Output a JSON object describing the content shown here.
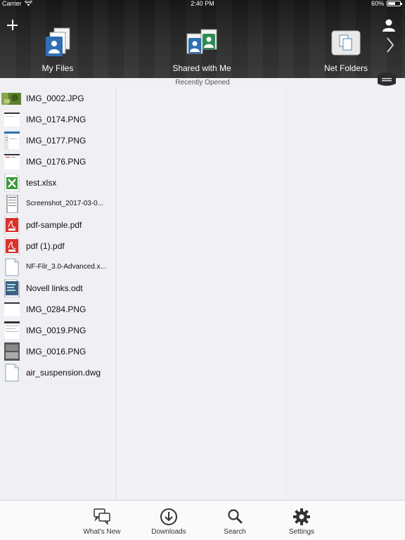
{
  "status": {
    "carrier": "Carrier",
    "time": "2:40 PM",
    "battery": "60%",
    "battery_level": 0.6
  },
  "header": {
    "tabs": [
      {
        "label": "My Files",
        "icon": "my-files-icon"
      },
      {
        "label": "Shared with Me",
        "icon": "shared-with-me-icon"
      },
      {
        "label": "Net Folders",
        "icon": "net-folders-icon"
      }
    ],
    "section_title": "Recently Opened"
  },
  "files": [
    {
      "name": "IMG_0002.JPG",
      "icon": "photo-thumbnail"
    },
    {
      "name": "IMG_0174.PNG",
      "icon": "screenshot-thumbnail"
    },
    {
      "name": "IMG_0177.PNG",
      "icon": "screenshot-thumbnail"
    },
    {
      "name": "IMG_0176.PNG",
      "icon": "screenshot-thumbnail"
    },
    {
      "name": "test.xlsx",
      "icon": "excel-icon"
    },
    {
      "name": "Screenshot_2017-03-0...",
      "icon": "screenshot-thumbnail"
    },
    {
      "name": "pdf-sample.pdf",
      "icon": "pdf-icon"
    },
    {
      "name": "pdf (1).pdf",
      "icon": "pdf-icon"
    },
    {
      "name": "NF-Filr_3.0-Advanced.x...",
      "icon": "generic-file-icon"
    },
    {
      "name": "Novell links.odt",
      "icon": "document-icon"
    },
    {
      "name": "IMG_0284.PNG",
      "icon": "screenshot-thumbnail"
    },
    {
      "name": "IMG_0019.PNG",
      "icon": "screenshot-thumbnail"
    },
    {
      "name": "IMG_0016.PNG",
      "icon": "screenshot-thumbnail"
    },
    {
      "name": "air_suspension.dwg",
      "icon": "generic-file-icon"
    }
  ],
  "tabbar": [
    {
      "label": "What's New",
      "icon": "chat-bubbles-icon"
    },
    {
      "label": "Downloads",
      "icon": "download-icon"
    },
    {
      "label": "Search",
      "icon": "search-icon"
    },
    {
      "label": "Settings",
      "icon": "gear-icon"
    }
  ],
  "colors": {
    "header_bg": "#2a2a2a",
    "accent_blue": "#2f6fb3",
    "accent_green": "#2e8b57",
    "pdf_red": "#d9322b",
    "excel_green": "#3a9a3a"
  }
}
